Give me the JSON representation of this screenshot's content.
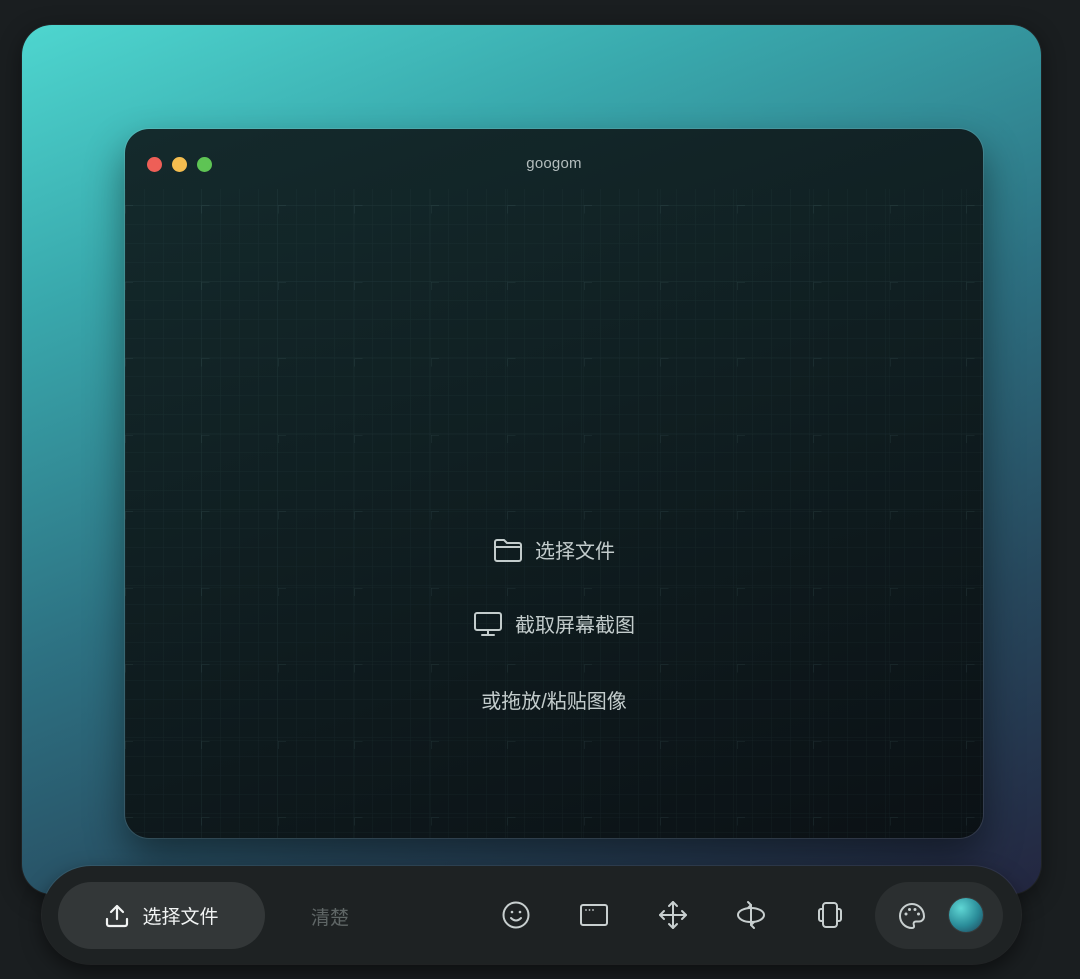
{
  "window": {
    "title": "googom"
  },
  "dropzone": {
    "choose_file": "选择文件",
    "capture_screenshot": "截取屏幕截图",
    "drag_hint": "或拖放/粘贴图像"
  },
  "toolbar": {
    "upload_label": "选择文件",
    "clear_label": "清楚",
    "tools": [
      "smiley-icon",
      "browser-frame-icon",
      "move-icon",
      "rotate-icon",
      "layers-icon"
    ],
    "theme_icon": "palette-icon",
    "active_color_gradient": [
      "#5fd6d4",
      "#2a8c99",
      "#1f3f55"
    ]
  },
  "colors": {
    "stage_gradient": [
      "#4ed6cf",
      "#39a9ad",
      "#2d7182",
      "#27485d",
      "#232640"
    ],
    "window_bg": "#0f1c1f",
    "traffic_red": "#ee5f57",
    "traffic_yellow": "#f4bd4f",
    "traffic_green": "#5ec454"
  }
}
